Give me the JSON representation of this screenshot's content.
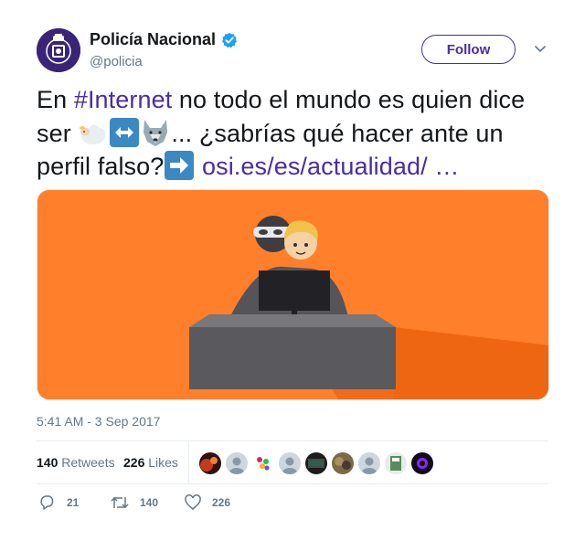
{
  "user": {
    "name": "Policía Nacional",
    "handle": "@policia",
    "verified": true,
    "follow_label": "Follow"
  },
  "tweet": {
    "text_parts": [
      "En ",
      "#Internet",
      " no todo el mundo es quien dice ser ",
      "... ¿sabrías qué hacer ante un perfil falso?",
      " ",
      "osi.es/es/actualidad/",
      "  …"
    ],
    "emoji": [
      "sheep-emoji",
      "left-right-arrow-emoji",
      "wolf-emoji",
      "right-arrow-emoji"
    ],
    "timestamp": "5:41 AM - 3 Sep 2017"
  },
  "stats": {
    "retweets_count": "140",
    "retweets_label": "Retweets",
    "likes_count": "226",
    "likes_label": "Likes",
    "liker_avatars": 9
  },
  "actions": {
    "reply_count": "21",
    "retweet_count": "140",
    "like_count": "226"
  },
  "colors": {
    "accent": "#4a2ca3",
    "media_background": "#ff7f2a",
    "secondary_text": "#657786"
  }
}
